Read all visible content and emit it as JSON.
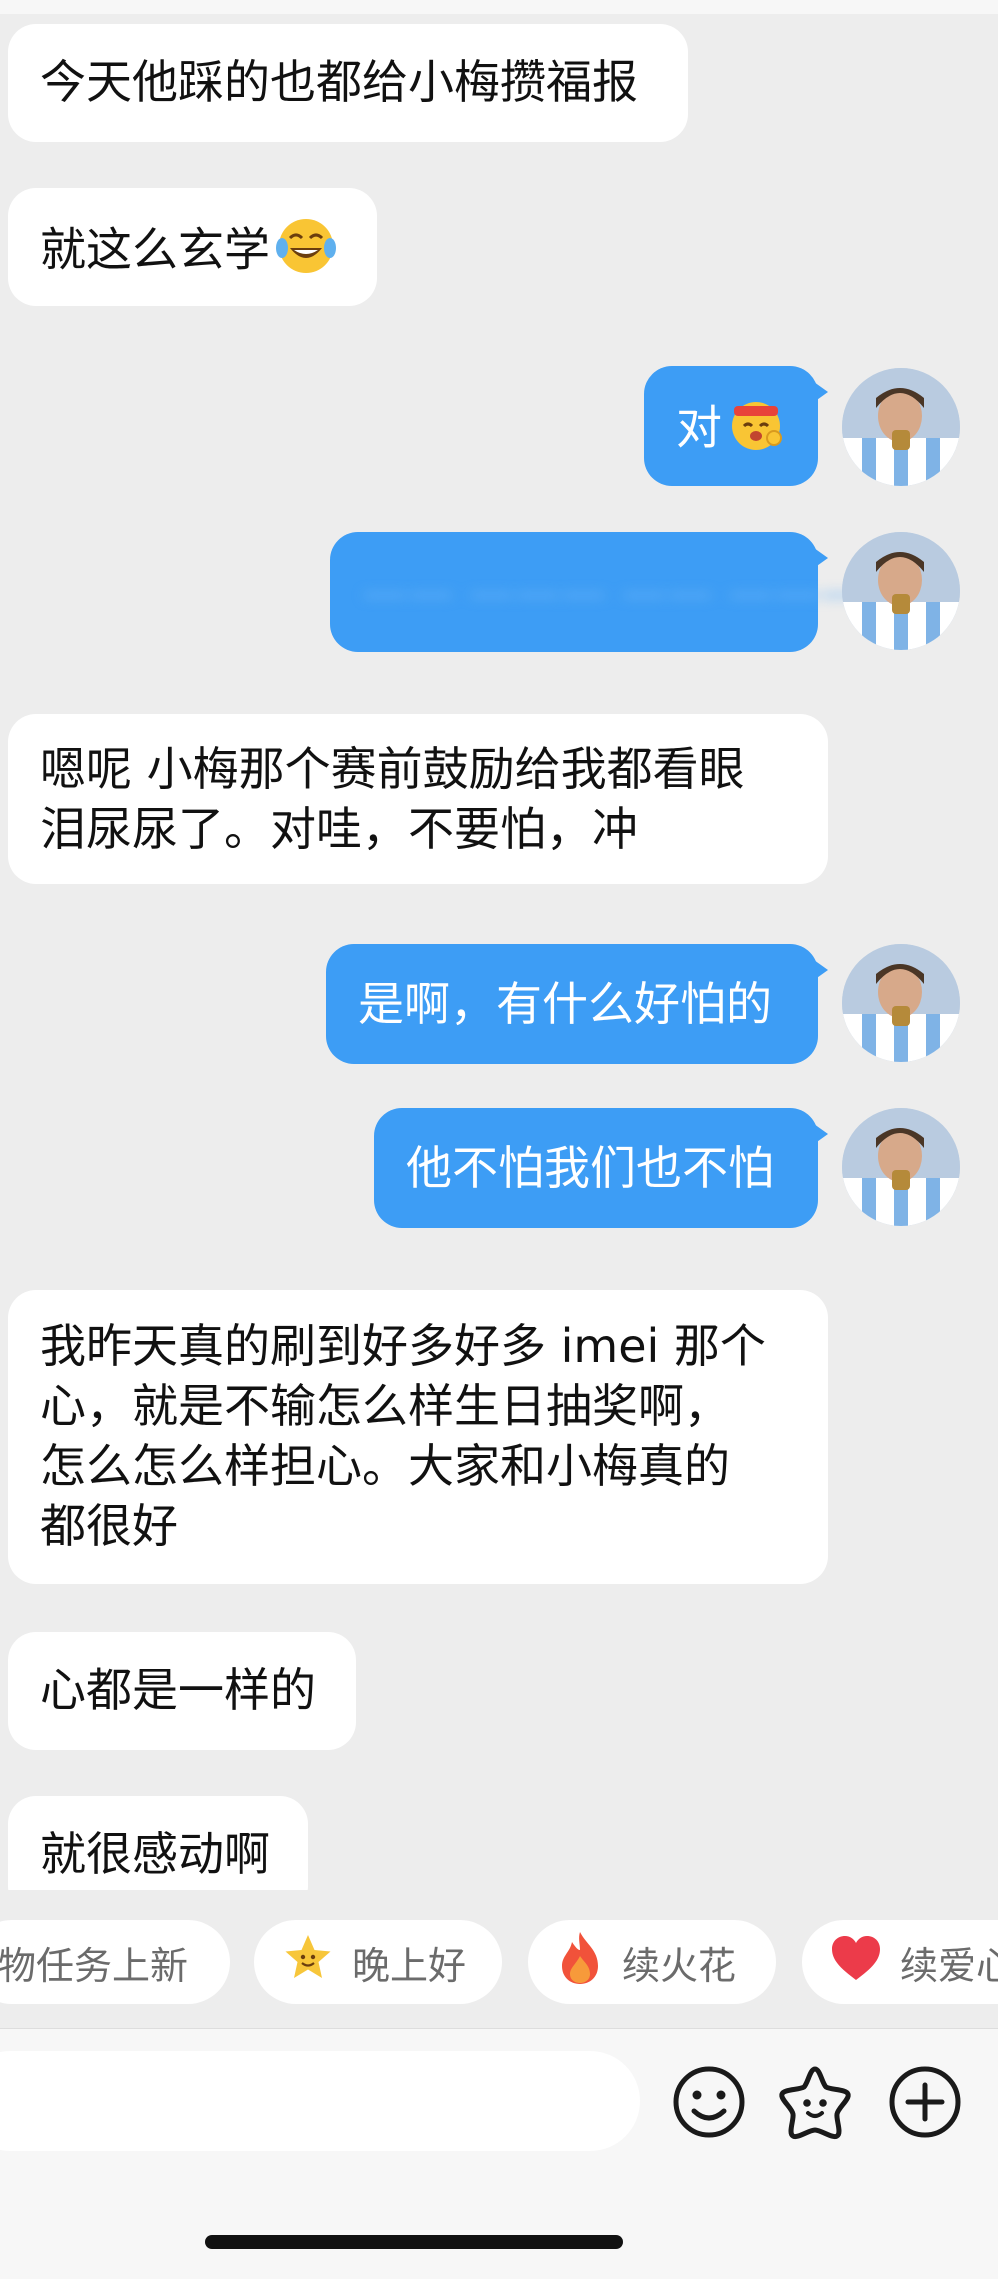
{
  "messages": [
    {
      "side": "in",
      "lines": [
        "今天他踩的也都给小梅攒福报"
      ]
    },
    {
      "side": "in",
      "lines": [
        "就这么玄学"
      ],
      "emoji": "laughing-tears-emoji"
    },
    {
      "side": "out",
      "lines": [
        "对"
      ],
      "emoji": "cheering-emoji"
    },
    {
      "side": "out",
      "lines": [
        "—— ——— —— ———"
      ],
      "blurred": true
    },
    {
      "side": "in",
      "lines": [
        "嗯呢 小梅那个赛前鼓励给我都看眼",
        "泪尿尿了。对哇，不要怕，冲"
      ]
    },
    {
      "side": "out",
      "lines": [
        "是啊，有什么好怕的"
      ]
    },
    {
      "side": "out",
      "lines": [
        "他不怕我们也不怕"
      ]
    },
    {
      "side": "in",
      "lines": [
        "我昨天真的刷到好多好多 imei 那个",
        "心，就是不输怎么样生日抽奖啊，",
        "怎么怎么样担心。大家和小梅真的",
        "都很好"
      ]
    },
    {
      "side": "in",
      "lines": [
        "心都是一样的"
      ]
    },
    {
      "side": "in",
      "lines": [
        "就很感动啊"
      ]
    }
  ],
  "quick_replies": [
    {
      "label": "物任务上新",
      "icon": ""
    },
    {
      "label": "晚上好",
      "icon": "star-smile-icon"
    },
    {
      "label": "续火花",
      "icon": "flame-icon"
    },
    {
      "label": "续爱心",
      "icon": "heart-icon"
    }
  ],
  "input_bar": {
    "placeholder": "",
    "icons": [
      "emoji-smile-icon",
      "sticker-star-icon",
      "plus-circle-icon"
    ]
  },
  "colors": {
    "background": "#ededed",
    "outgoing_bubble": "#3d9df5",
    "incoming_bubble": "#ffffff",
    "chip_text": "#6b6b6b"
  }
}
